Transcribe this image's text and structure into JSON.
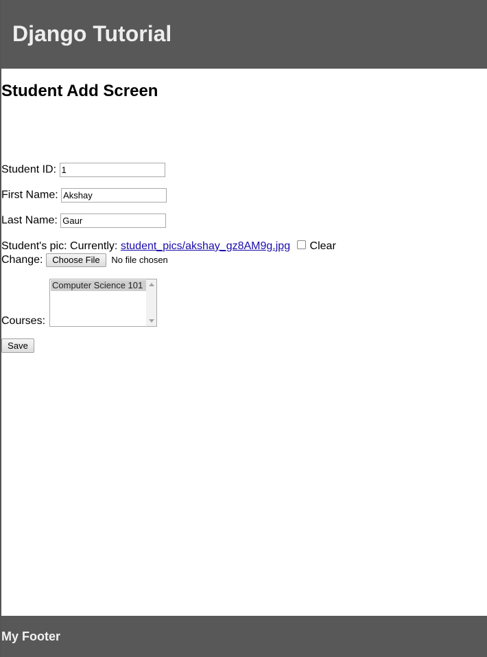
{
  "header": {
    "title": "Django Tutorial"
  },
  "page_title": "Student Add Screen",
  "form": {
    "student_id": {
      "label": "Student ID:",
      "value": "1"
    },
    "first_name": {
      "label": "First Name:",
      "value": "Akshay"
    },
    "last_name": {
      "label": "Last Name:",
      "value": "Gaur"
    },
    "pic": {
      "label": "Student's pic:",
      "currently_label": "Currently:",
      "current_file": "student_pics/akshay_gz8AM9g.jpg",
      "clear_label": "Clear",
      "clear_checked": false,
      "change_label": "Change:",
      "choose_button": "Choose File",
      "no_file_text": "No file chosen"
    },
    "courses": {
      "label": "Courses:",
      "options": [
        "Computer Science 101"
      ],
      "selected": "Computer Science 101"
    },
    "save_button": "Save"
  },
  "footer": {
    "text": "My Footer"
  },
  "colors": {
    "header_bg": "#585858",
    "footer_bg": "#585858",
    "link": "#1a0dab"
  }
}
